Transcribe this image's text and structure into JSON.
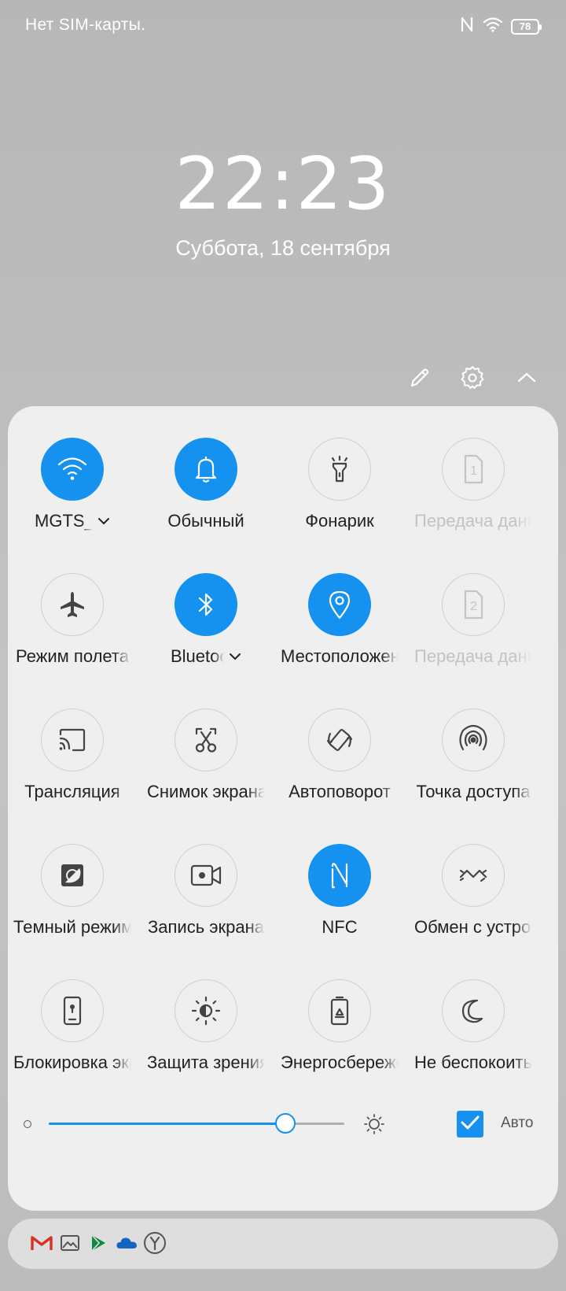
{
  "status_bar": {
    "carrier": "Нет SIM-карты.",
    "battery_level": "78",
    "icons": [
      "nfc-icon",
      "wifi-icon",
      "battery-icon"
    ]
  },
  "lockscreen": {
    "time": "22:23",
    "date": "Суббота, 18 сентября"
  },
  "header_actions": [
    {
      "icon": "pencil-icon",
      "name": "edit-button"
    },
    {
      "icon": "gear-icon",
      "name": "settings-button"
    },
    {
      "icon": "chevron-up-icon",
      "name": "collapse-button"
    }
  ],
  "tiles": [
    {
      "label": "MGTS_",
      "state": "on",
      "icon": "wifi-icon",
      "chevron": true
    },
    {
      "label": "Обычный",
      "state": "on",
      "icon": "bell-icon"
    },
    {
      "label": "Фонарик",
      "state": "off",
      "icon": "flashlight-icon"
    },
    {
      "label": "Передача данных",
      "state": "disabled",
      "icon": "sim1-icon"
    },
    {
      "label": "Режим полета",
      "state": "off",
      "icon": "airplane-icon"
    },
    {
      "label": "Bluetooth",
      "state": "on",
      "icon": "bluetooth-icon",
      "chevron": true
    },
    {
      "label": "Местоположение",
      "state": "on",
      "icon": "location-icon"
    },
    {
      "label": "Передача данных",
      "state": "disabled",
      "icon": "sim2-icon"
    },
    {
      "label": "Трансляция",
      "state": "off",
      "icon": "cast-icon"
    },
    {
      "label": "Снимок экрана",
      "state": "off",
      "icon": "scissors-icon"
    },
    {
      "label": "Автоповорот",
      "state": "off",
      "icon": "autorotate-icon"
    },
    {
      "label": "Точка доступа",
      "state": "off",
      "icon": "hotspot-icon"
    },
    {
      "label": "Темный режим",
      "state": "off",
      "icon": "dark-mode-icon"
    },
    {
      "label": "Запись экрана",
      "state": "off",
      "icon": "screen-record-icon"
    },
    {
      "label": "NFC",
      "state": "on",
      "icon": "nfc-icon"
    },
    {
      "label": "Обмен с устройствами",
      "state": "off",
      "icon": "share-icon"
    },
    {
      "label": "Блокировка экрана",
      "state": "off",
      "icon": "lock-screen-icon"
    },
    {
      "label": "Защита зрения",
      "state": "off",
      "icon": "eye-comfort-icon"
    },
    {
      "label": "Энергосбережение",
      "state": "off",
      "icon": "battery-saver-icon"
    },
    {
      "label": "Не беспокоить",
      "state": "off",
      "icon": "moon-icon"
    }
  ],
  "brightness": {
    "level": 0.8,
    "auto_checked": true,
    "auto_label": "Авто"
  },
  "notification_icons": [
    "gmail-icon",
    "gallery-icon",
    "play-store-icon",
    "cloud-icon",
    "yandex-icon"
  ],
  "colors": {
    "accent": "#1592ef",
    "panel_bg": "#efeff0",
    "text": "#222222",
    "disabled_text": "#c2c2c4"
  }
}
